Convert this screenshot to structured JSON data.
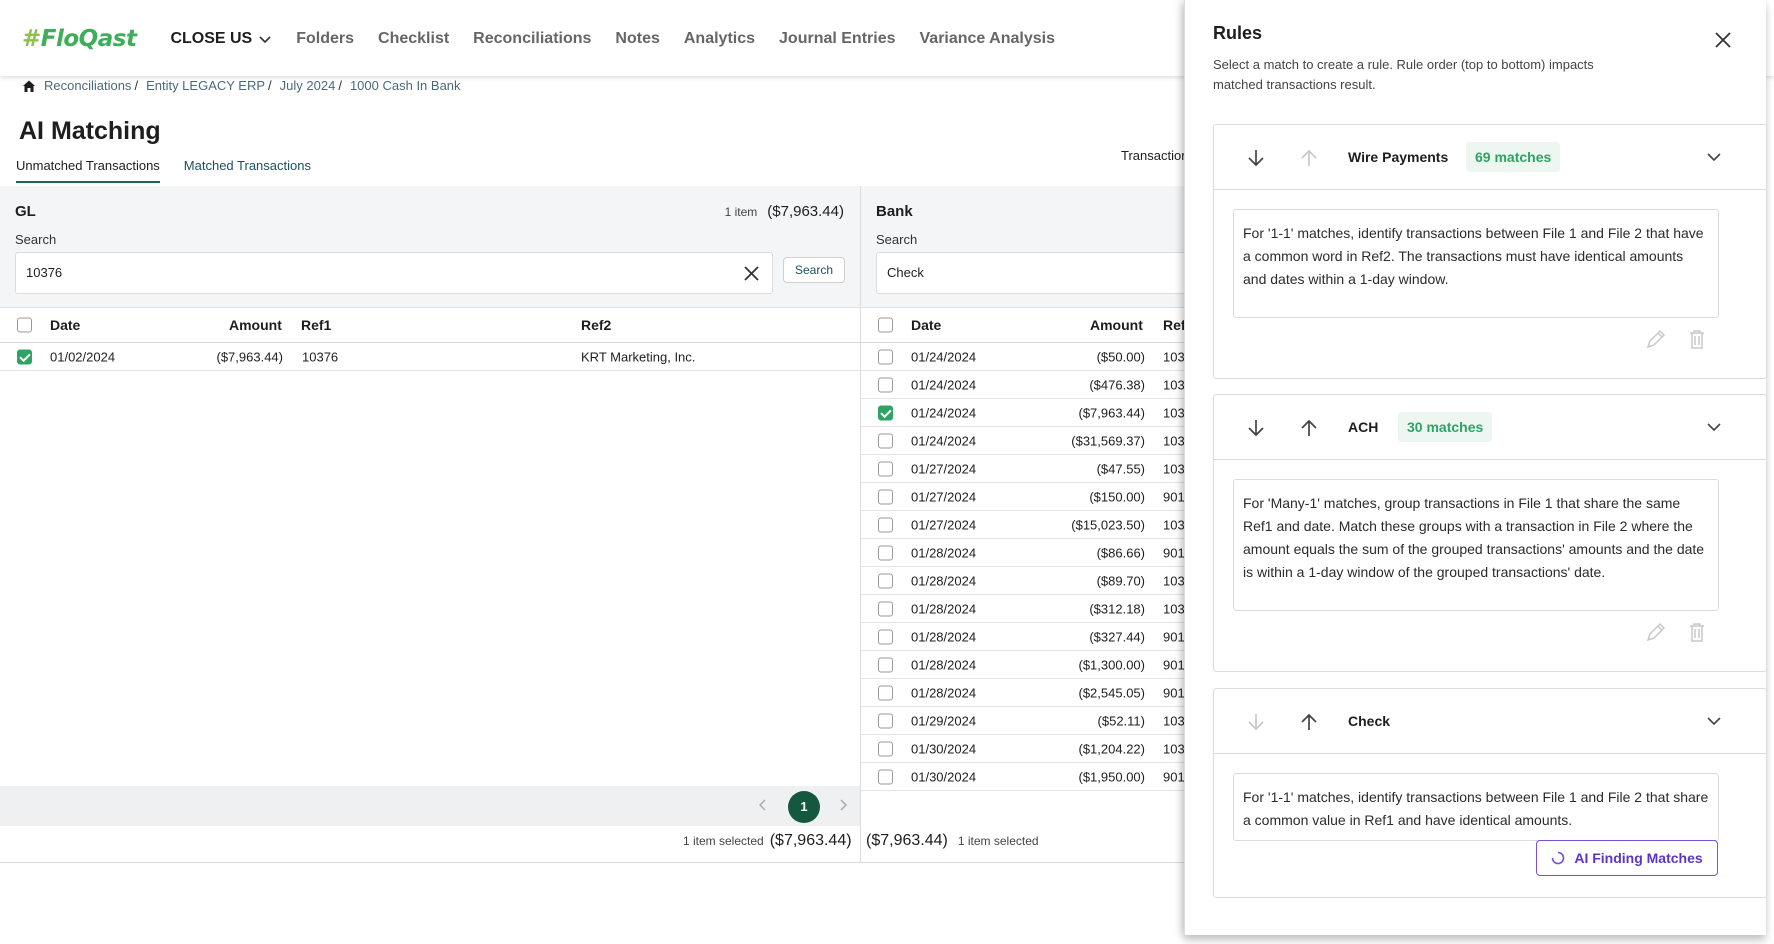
{
  "nav": {
    "logo": "FloQast",
    "close_label": "CLOSE US",
    "items": [
      "Folders",
      "Checklist",
      "Reconciliations",
      "Notes",
      "Analytics",
      "Journal Entries",
      "Variance Analysis"
    ]
  },
  "breadcrumb": [
    "Reconciliations",
    "Entity LEGACY ERP",
    "July 2024",
    "1000 Cash In Bank"
  ],
  "page_title": "AI Matching",
  "tabs": [
    "Unmatched Transactions",
    "Matched Transactions"
  ],
  "transactions_label": "Transaction",
  "gl": {
    "title": "GL",
    "count": "1 item",
    "total": "($7,963.44)",
    "search_label": "Search",
    "search_value": "10376",
    "search_button": "Search",
    "columns": [
      "Date",
      "Amount",
      "Ref1",
      "Ref2"
    ],
    "rows": [
      {
        "date": "01/02/2024",
        "amount": "($7,963.44)",
        "ref1": "10376",
        "ref2": "KRT Marketing, Inc.",
        "checked": true
      }
    ],
    "page": "1",
    "selected_label": "1 item selected",
    "selected_amount": "($7,963.44)"
  },
  "bank": {
    "title": "Bank",
    "search_label": "Search",
    "search_value": "Check",
    "columns": [
      "Date",
      "Amount",
      "Ref"
    ],
    "rows": [
      {
        "date": "01/24/2024",
        "amount": "($50.00)",
        "ref": "103",
        "checked": false
      },
      {
        "date": "01/24/2024",
        "amount": "($476.38)",
        "ref": "103",
        "checked": false
      },
      {
        "date": "01/24/2024",
        "amount": "($7,963.44)",
        "ref": "103",
        "checked": true
      },
      {
        "date": "01/24/2024",
        "amount": "($31,569.37)",
        "ref": "103",
        "checked": false
      },
      {
        "date": "01/27/2024",
        "amount": "($47.55)",
        "ref": "103",
        "checked": false
      },
      {
        "date": "01/27/2024",
        "amount": "($150.00)",
        "ref": "901",
        "checked": false
      },
      {
        "date": "01/27/2024",
        "amount": "($15,023.50)",
        "ref": "103",
        "checked": false
      },
      {
        "date": "01/28/2024",
        "amount": "($86.66)",
        "ref": "901",
        "checked": false
      },
      {
        "date": "01/28/2024",
        "amount": "($89.70)",
        "ref": "103",
        "checked": false
      },
      {
        "date": "01/28/2024",
        "amount": "($312.18)",
        "ref": "103",
        "checked": false
      },
      {
        "date": "01/28/2024",
        "amount": "($327.44)",
        "ref": "901",
        "checked": false
      },
      {
        "date": "01/28/2024",
        "amount": "($1,300.00)",
        "ref": "901",
        "checked": false
      },
      {
        "date": "01/28/2024",
        "amount": "($2,545.05)",
        "ref": "901",
        "checked": false
      },
      {
        "date": "01/29/2024",
        "amount": "($52.11)",
        "ref": "103",
        "checked": false
      },
      {
        "date": "01/30/2024",
        "amount": "($1,204.22)",
        "ref": "103",
        "checked": false
      },
      {
        "date": "01/30/2024",
        "amount": "($1,950.00)",
        "ref": "901",
        "checked": false
      }
    ],
    "selected_label": "1 item selected",
    "selected_amount": "($7,963.44)"
  },
  "rules": {
    "title": "Rules",
    "description": "Select a match to create a rule. Rule order (top to bottom) impacts matched transactions result.",
    "items": [
      {
        "name": "Wire Payments",
        "badge": "69 matches",
        "text": "For '1-1' matches, identify transactions between File 1 and File 2 that have a common word in Ref2. The transactions must have identical amounts and dates within a 1-day window."
      },
      {
        "name": "ACH",
        "badge": "30 matches",
        "text": "For 'Many-1' matches, group transactions in File 1 that share the same Ref1 and date. Match these groups with a transaction in File 2 where the amount equals the sum of the grouped transactions' amounts and the date is within a 1-day window of the grouped transactions' date."
      },
      {
        "name": "Check",
        "badge": "",
        "text": "For '1-1' matches, identify transactions between File 1 and File 2 that share a common value in Ref1 and have identical amounts."
      }
    ],
    "ai_button": "AI Finding Matches"
  },
  "colors": {
    "brand_green": "#3fae5a",
    "accent": "#16583f",
    "check_green": "#2ea463",
    "ai_purple": "#7b4fd6"
  }
}
